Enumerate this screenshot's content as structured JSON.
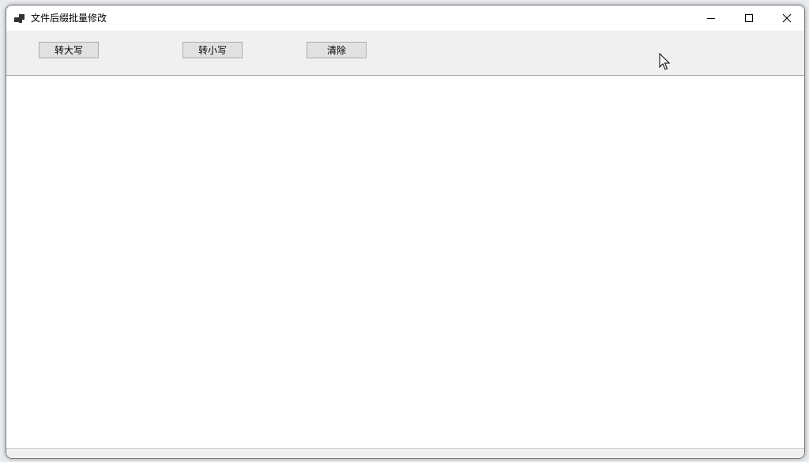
{
  "window": {
    "title": "文件后缀批量修改",
    "icon": "app-window-icon",
    "controls": {
      "minimize_icon": "minimize-icon",
      "maximize_icon": "maximize-icon",
      "close_icon": "close-icon"
    }
  },
  "toolbar": {
    "to_upper_label": "转大写",
    "to_lower_label": "转小写",
    "clear_label": "清除"
  },
  "colors": {
    "toolbar_bg": "#f0f0f0",
    "button_bg": "#e1e1e1",
    "button_border": "#adadad",
    "content_bg": "#ffffff"
  }
}
